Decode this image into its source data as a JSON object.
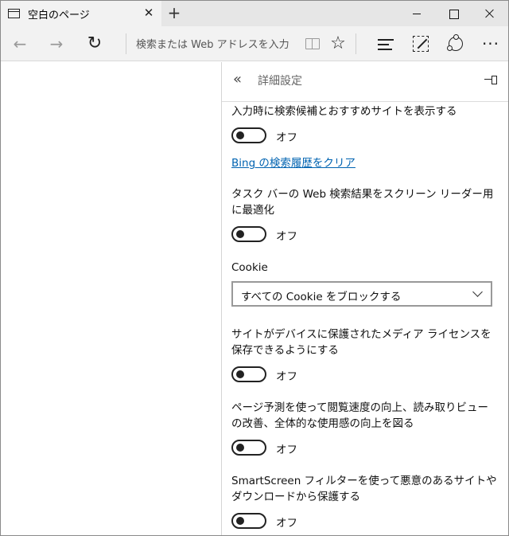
{
  "tab": {
    "title": "空白のページ",
    "close_symbol": "✕",
    "new_tab_symbol": "+"
  },
  "toolbar": {
    "back_symbol": "←",
    "forward_symbol": "→",
    "refresh_symbol": "↻",
    "address_placeholder": "検索または Web アドレスを入力",
    "favorite_symbol": "☆",
    "more_symbol": "···"
  },
  "panel": {
    "back_symbol": "«",
    "title": "詳細設定",
    "settings": [
      {
        "label": "入力時に検索候補とおすすめサイトを表示する",
        "state": "オフ"
      },
      {
        "label": "タスク バーの Web 検索結果をスクリーン リーダー用に最適化",
        "state": "オフ"
      },
      {
        "label": "サイトがデバイスに保護されたメディア ライセンスを保存できるようにする",
        "state": "オフ"
      },
      {
        "label": "ページ予測を使って閲覧速度の向上、読み取りビューの改善、全体的な使用感の向上を図る",
        "state": "オフ"
      },
      {
        "label": "SmartScreen フィルターを使って悪意のあるサイトやダウンロードから保護する",
        "state": "オフ"
      }
    ],
    "clear_history_link": "Bing の検索履歴をクリア",
    "cookie": {
      "label": "Cookie",
      "selected": "すべての Cookie をブロックする"
    }
  }
}
